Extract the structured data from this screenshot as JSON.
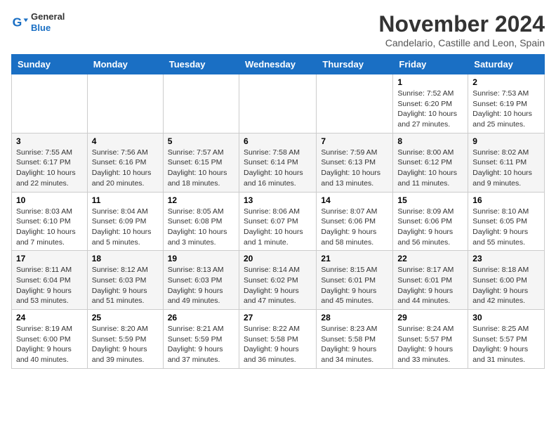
{
  "header": {
    "logo_general": "General",
    "logo_blue": "Blue",
    "month_title": "November 2024",
    "location": "Candelario, Castille and Leon, Spain"
  },
  "days_of_week": [
    "Sunday",
    "Monday",
    "Tuesday",
    "Wednesday",
    "Thursday",
    "Friday",
    "Saturday"
  ],
  "weeks": [
    [
      {
        "day": "",
        "info": ""
      },
      {
        "day": "",
        "info": ""
      },
      {
        "day": "",
        "info": ""
      },
      {
        "day": "",
        "info": ""
      },
      {
        "day": "",
        "info": ""
      },
      {
        "day": "1",
        "info": "Sunrise: 7:52 AM\nSunset: 6:20 PM\nDaylight: 10 hours and 27 minutes."
      },
      {
        "day": "2",
        "info": "Sunrise: 7:53 AM\nSunset: 6:19 PM\nDaylight: 10 hours and 25 minutes."
      }
    ],
    [
      {
        "day": "3",
        "info": "Sunrise: 7:55 AM\nSunset: 6:17 PM\nDaylight: 10 hours and 22 minutes."
      },
      {
        "day": "4",
        "info": "Sunrise: 7:56 AM\nSunset: 6:16 PM\nDaylight: 10 hours and 20 minutes."
      },
      {
        "day": "5",
        "info": "Sunrise: 7:57 AM\nSunset: 6:15 PM\nDaylight: 10 hours and 18 minutes."
      },
      {
        "day": "6",
        "info": "Sunrise: 7:58 AM\nSunset: 6:14 PM\nDaylight: 10 hours and 16 minutes."
      },
      {
        "day": "7",
        "info": "Sunrise: 7:59 AM\nSunset: 6:13 PM\nDaylight: 10 hours and 13 minutes."
      },
      {
        "day": "8",
        "info": "Sunrise: 8:00 AM\nSunset: 6:12 PM\nDaylight: 10 hours and 11 minutes."
      },
      {
        "day": "9",
        "info": "Sunrise: 8:02 AM\nSunset: 6:11 PM\nDaylight: 10 hours and 9 minutes."
      }
    ],
    [
      {
        "day": "10",
        "info": "Sunrise: 8:03 AM\nSunset: 6:10 PM\nDaylight: 10 hours and 7 minutes."
      },
      {
        "day": "11",
        "info": "Sunrise: 8:04 AM\nSunset: 6:09 PM\nDaylight: 10 hours and 5 minutes."
      },
      {
        "day": "12",
        "info": "Sunrise: 8:05 AM\nSunset: 6:08 PM\nDaylight: 10 hours and 3 minutes."
      },
      {
        "day": "13",
        "info": "Sunrise: 8:06 AM\nSunset: 6:07 PM\nDaylight: 10 hours and 1 minute."
      },
      {
        "day": "14",
        "info": "Sunrise: 8:07 AM\nSunset: 6:06 PM\nDaylight: 9 hours and 58 minutes."
      },
      {
        "day": "15",
        "info": "Sunrise: 8:09 AM\nSunset: 6:06 PM\nDaylight: 9 hours and 56 minutes."
      },
      {
        "day": "16",
        "info": "Sunrise: 8:10 AM\nSunset: 6:05 PM\nDaylight: 9 hours and 55 minutes."
      }
    ],
    [
      {
        "day": "17",
        "info": "Sunrise: 8:11 AM\nSunset: 6:04 PM\nDaylight: 9 hours and 53 minutes."
      },
      {
        "day": "18",
        "info": "Sunrise: 8:12 AM\nSunset: 6:03 PM\nDaylight: 9 hours and 51 minutes."
      },
      {
        "day": "19",
        "info": "Sunrise: 8:13 AM\nSunset: 6:03 PM\nDaylight: 9 hours and 49 minutes."
      },
      {
        "day": "20",
        "info": "Sunrise: 8:14 AM\nSunset: 6:02 PM\nDaylight: 9 hours and 47 minutes."
      },
      {
        "day": "21",
        "info": "Sunrise: 8:15 AM\nSunset: 6:01 PM\nDaylight: 9 hours and 45 minutes."
      },
      {
        "day": "22",
        "info": "Sunrise: 8:17 AM\nSunset: 6:01 PM\nDaylight: 9 hours and 44 minutes."
      },
      {
        "day": "23",
        "info": "Sunrise: 8:18 AM\nSunset: 6:00 PM\nDaylight: 9 hours and 42 minutes."
      }
    ],
    [
      {
        "day": "24",
        "info": "Sunrise: 8:19 AM\nSunset: 6:00 PM\nDaylight: 9 hours and 40 minutes."
      },
      {
        "day": "25",
        "info": "Sunrise: 8:20 AM\nSunset: 5:59 PM\nDaylight: 9 hours and 39 minutes."
      },
      {
        "day": "26",
        "info": "Sunrise: 8:21 AM\nSunset: 5:59 PM\nDaylight: 9 hours and 37 minutes."
      },
      {
        "day": "27",
        "info": "Sunrise: 8:22 AM\nSunset: 5:58 PM\nDaylight: 9 hours and 36 minutes."
      },
      {
        "day": "28",
        "info": "Sunrise: 8:23 AM\nSunset: 5:58 PM\nDaylight: 9 hours and 34 minutes."
      },
      {
        "day": "29",
        "info": "Sunrise: 8:24 AM\nSunset: 5:57 PM\nDaylight: 9 hours and 33 minutes."
      },
      {
        "day": "30",
        "info": "Sunrise: 8:25 AM\nSunset: 5:57 PM\nDaylight: 9 hours and 31 minutes."
      }
    ]
  ]
}
